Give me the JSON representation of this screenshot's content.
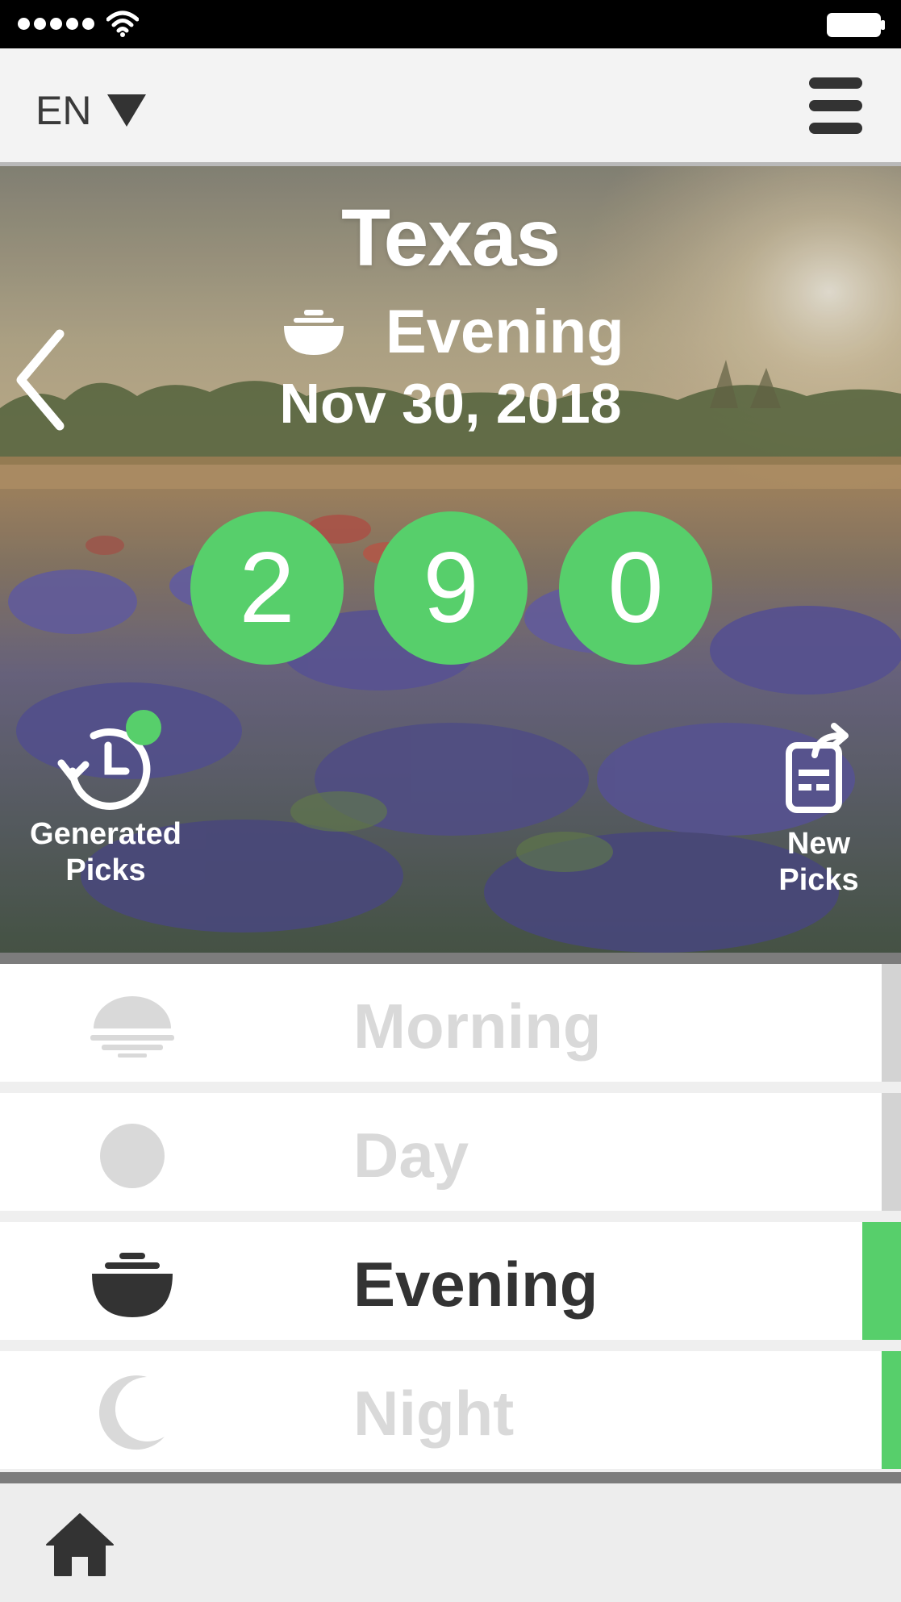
{
  "status_bar": {
    "signal_dots": 5,
    "battery": "full"
  },
  "nav": {
    "language": "EN"
  },
  "hero": {
    "state": "Texas",
    "period": "Evening",
    "date": "Nov 30, 2018",
    "numbers": [
      "2",
      "9",
      "0"
    ],
    "generated_picks_line1": "Generated",
    "generated_picks_line2": "Picks",
    "new_picks_line1": "New",
    "new_picks_line2": "Picks"
  },
  "draw_times": [
    {
      "label": "Morning",
      "icon": "sunrise-icon",
      "active": false
    },
    {
      "label": "Day",
      "icon": "sun-icon",
      "active": false
    },
    {
      "label": "Evening",
      "icon": "evening-bowl-icon",
      "active": true
    },
    {
      "label": "Night",
      "icon": "moon-icon",
      "active": false
    }
  ],
  "colors": {
    "accent": "#57cf6b",
    "active_text": "#333333",
    "inactive_text": "#d9d9d9"
  }
}
